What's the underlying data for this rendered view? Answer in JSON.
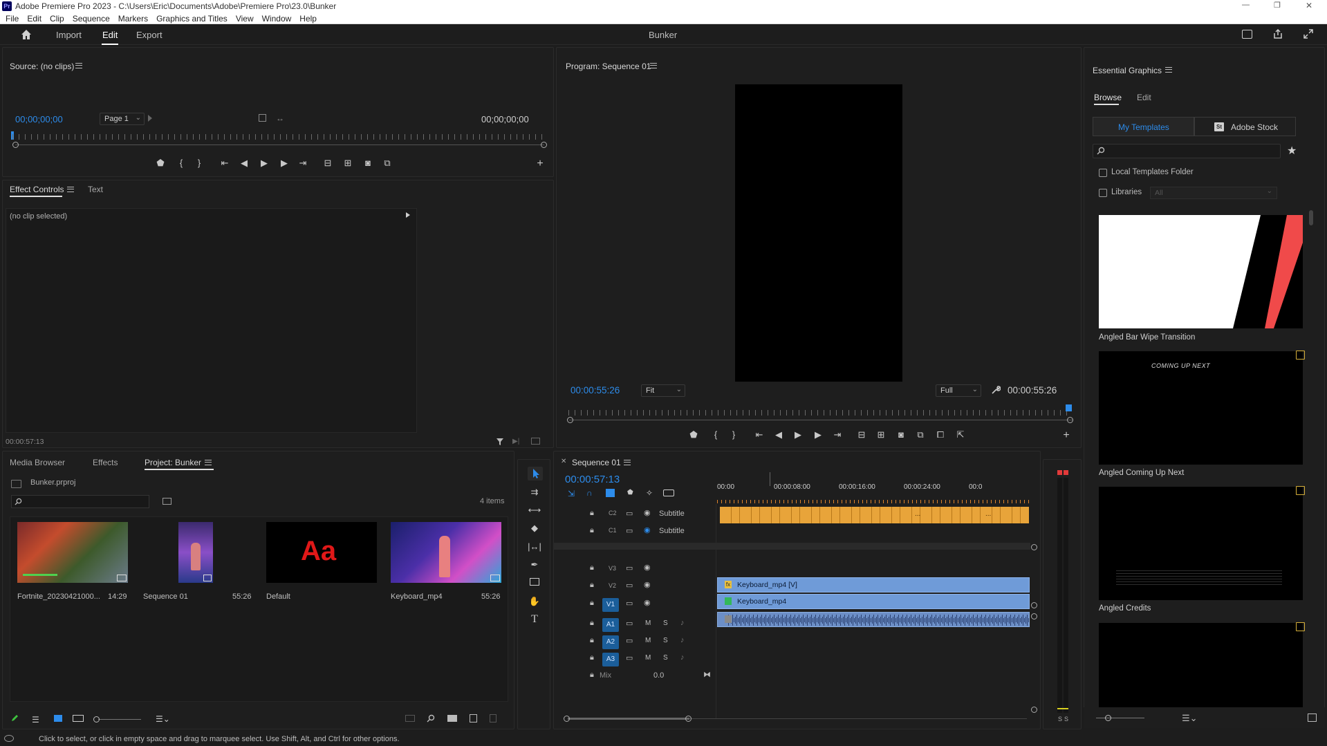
{
  "titlebar": {
    "app_badge": "Pr",
    "title": "Adobe Premiere Pro 2023 - C:\\Users\\Eric\\Documents\\Adobe\\Premiere Pro\\23.0\\Bunker",
    "minimize": "—",
    "maximize": "❐",
    "close": "✕"
  },
  "menubar": [
    "File",
    "Edit",
    "Clip",
    "Sequence",
    "Markers",
    "Graphics and Titles",
    "View",
    "Window",
    "Help"
  ],
  "workspace": {
    "tabs": [
      "Import",
      "Edit",
      "Export"
    ],
    "active_tab": "Edit",
    "project_title": "Bunker"
  },
  "source": {
    "title": "Source: (no clips)",
    "timecode_in": "00;00;00;00",
    "page_select": "Page 1",
    "timecode_out": "00;00;00;00"
  },
  "effect_controls": {
    "tabs": [
      "Effect Controls",
      "Text"
    ],
    "no_clip": "(no clip selected)",
    "timecode": "00:00:57:13"
  },
  "program": {
    "title": "Program: Sequence 01",
    "timecode": "00:00:55:26",
    "fit_select": "Fit",
    "quality_select": "Full",
    "duration": "00:00:55:26"
  },
  "essential_graphics": {
    "title": "Essential Graphics",
    "tabs": [
      "Browse",
      "Edit"
    ],
    "subtabs": [
      "My Templates",
      "Adobe Stock"
    ],
    "stock_badge": "St",
    "local_templates_label": "Local Templates Folder",
    "libraries_label": "Libraries",
    "libraries_select": "All",
    "templates": [
      {
        "name": "Angled Bar Wipe Transition"
      },
      {
        "name": "Angled Coming Up Next",
        "preview_text": "COMING UP NEXT"
      },
      {
        "name": "Angled Credits"
      },
      {
        "name": ""
      }
    ]
  },
  "project": {
    "tabs": [
      "Media Browser",
      "Effects",
      "Project: Bunker"
    ],
    "active_tab": "Project: Bunker",
    "file": "Bunker.prproj",
    "item_count": "4 items",
    "items": [
      {
        "name": "Fortnite_20230421000...",
        "duration": "14:29"
      },
      {
        "name": "Sequence 01",
        "duration": "55:26"
      },
      {
        "name": "Default",
        "duration": "",
        "preview_text": "Aa"
      },
      {
        "name": "Keyboard_mp4",
        "duration": "55:26"
      }
    ]
  },
  "timeline": {
    "title": "Sequence 01",
    "timecode": "00:00:57:13",
    "ruler": [
      "00:00",
      "00:00:08:00",
      "00:00:16:00",
      "00:00:24:00",
      "00:0"
    ],
    "tracks": {
      "c2": {
        "tag": "C2",
        "label": "Subtitle"
      },
      "c1": {
        "tag": "C1",
        "label": "Subtitle"
      },
      "v3": "V3",
      "v2": "V2",
      "v1": "V1",
      "a1": "A1",
      "a2": "A2",
      "a3": "A3",
      "mute": "M",
      "solo": "S",
      "mix_label": "Mix",
      "mix_value": "0.0"
    },
    "clips": {
      "v2": "Keyboard_mp4 [V]",
      "v1": "Keyboard_mp4",
      "fx_badge": "fx"
    },
    "subtitle_ellipsis": "..."
  },
  "meter": {
    "solo_left": "S",
    "solo_right": "S"
  },
  "status_bar": "Click to select, or click in empty space and drag to marquee select. Use Shift, Alt, and Ctrl for other options.",
  "colors": {
    "accent": "#2d8ceb",
    "subtitle_clip": "#e8a43a",
    "video_clip": "#6f9bd8",
    "audio_clip": "#6c8fc7",
    "panel_bg": "#1e1e1e"
  }
}
